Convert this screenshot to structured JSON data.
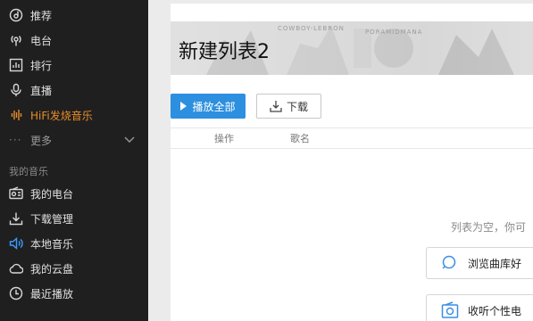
{
  "sidebar": {
    "items": [
      {
        "label": "推荐",
        "icon": "disc-icon"
      },
      {
        "label": "电台",
        "icon": "radio-icon"
      },
      {
        "label": "排行",
        "icon": "chart-icon"
      },
      {
        "label": "直播",
        "icon": "microphone-icon"
      },
      {
        "label": "HiFi发烧音乐",
        "icon": "soundwave-icon"
      },
      {
        "label": "更多",
        "icon": "more-dots-icon"
      }
    ],
    "section_title": "我的音乐",
    "my_items": [
      {
        "label": "我的电台",
        "icon": "radio-box-icon"
      },
      {
        "label": "下载管理",
        "icon": "download-icon"
      },
      {
        "label": "本地音乐",
        "icon": "speaker-icon"
      },
      {
        "label": "我的云盘",
        "icon": "cloud-icon"
      },
      {
        "label": "最近播放",
        "icon": "clock-icon"
      }
    ]
  },
  "playlist": {
    "title": "新建列表2",
    "banner_watermarks": [
      "COWBOY-LEBRON",
      "PORAMIDMANA"
    ],
    "play_all_label": "播放全部",
    "download_label": "下载",
    "columns": [
      "操作",
      "歌名"
    ],
    "empty_text": "列表为空，你可",
    "cards": [
      {
        "label": "浏览曲库好",
        "icon": "search-icon"
      },
      {
        "label": "收听个性电",
        "icon": "radio-icon"
      }
    ]
  },
  "colors": {
    "sidebar_bg": "#1f1f1f",
    "accent_blue": "#2d8fdf",
    "hifi_orange": "#e88d2a"
  }
}
